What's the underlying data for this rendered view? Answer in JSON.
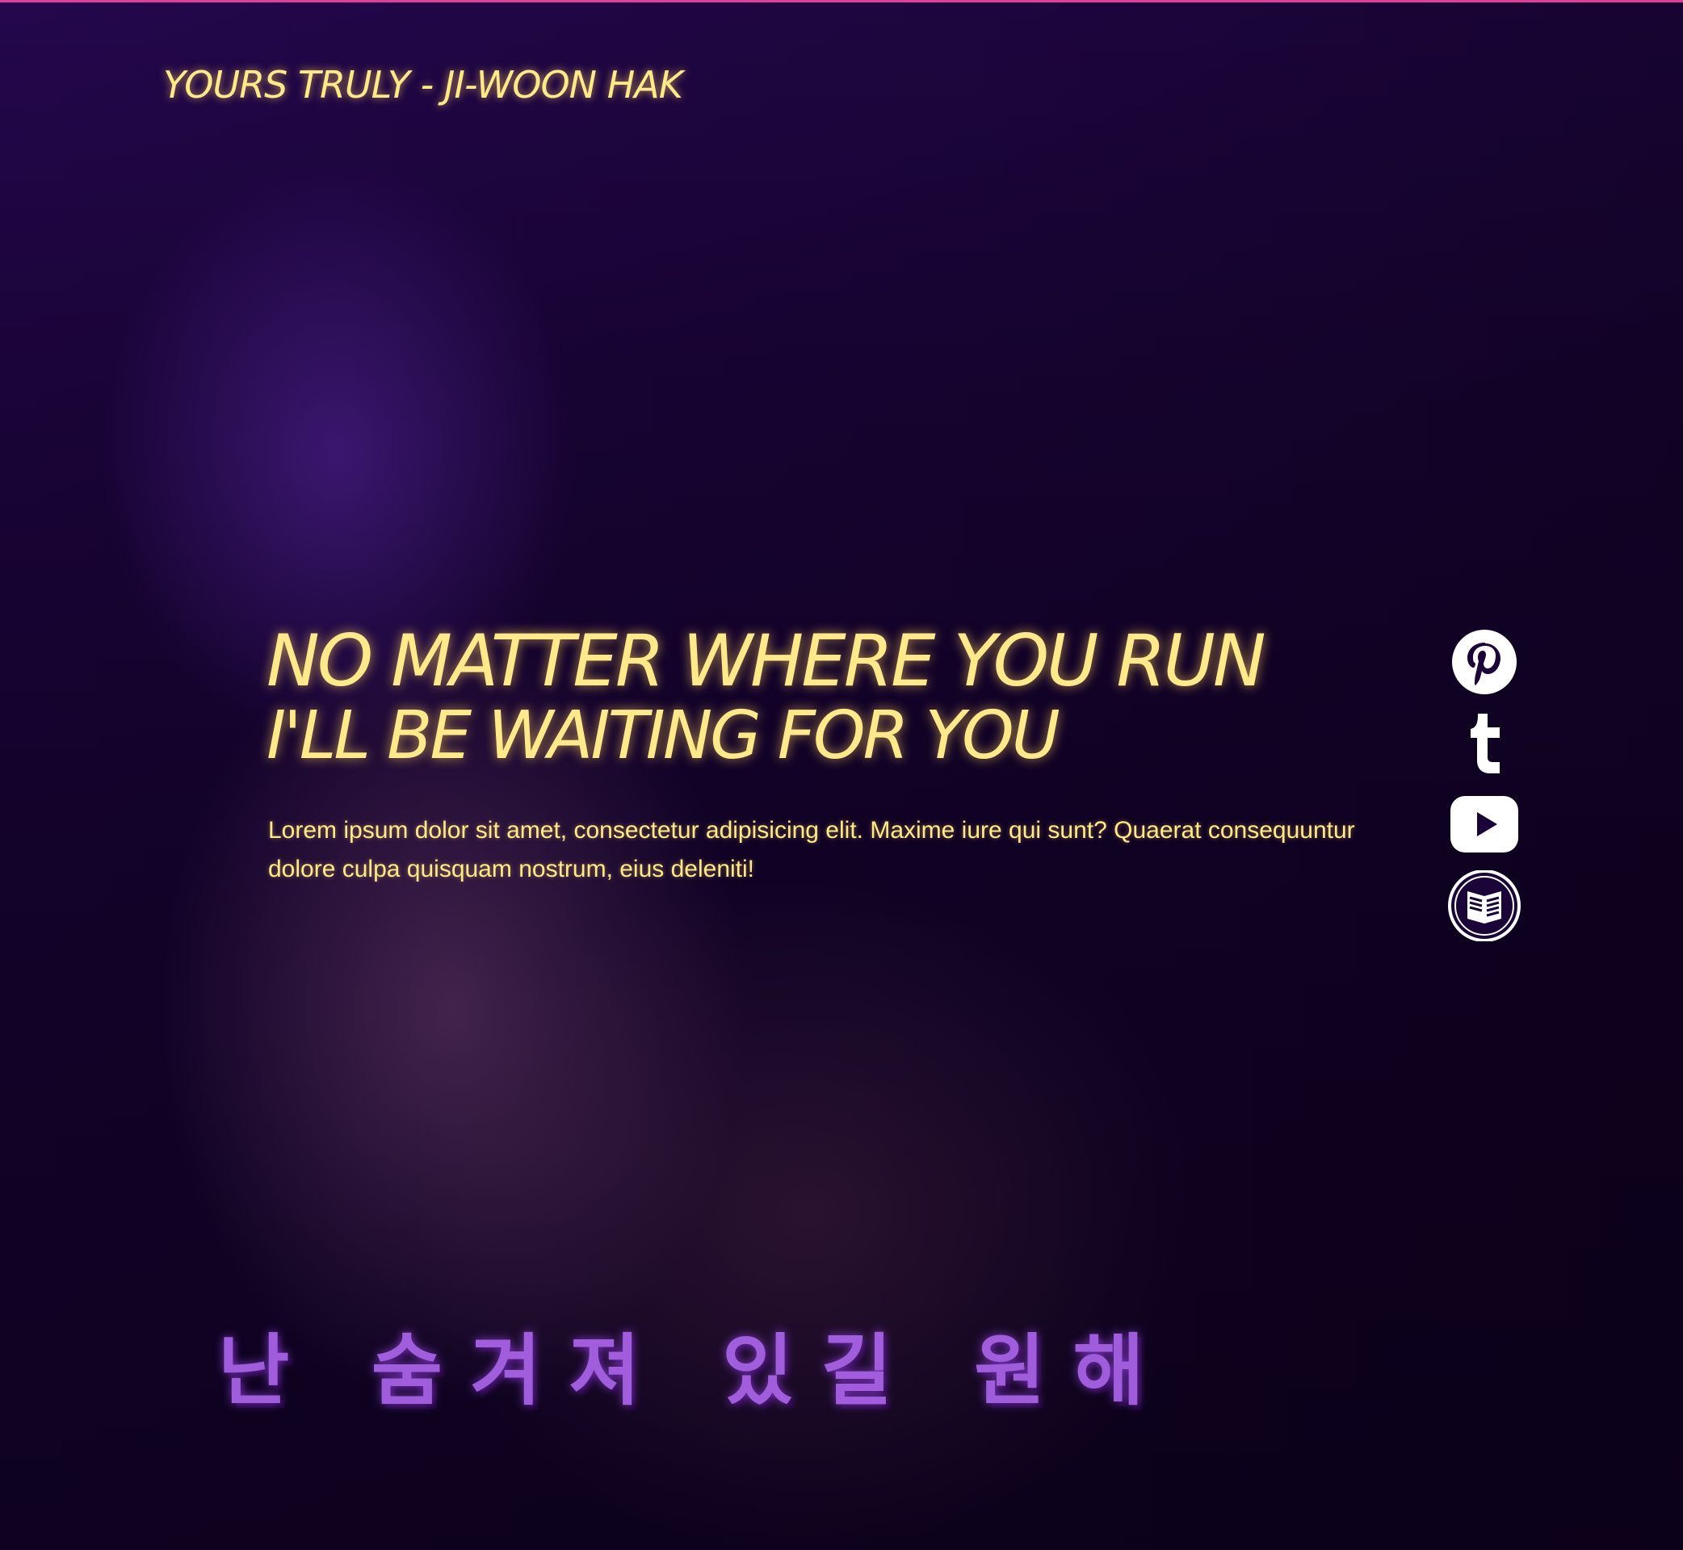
{
  "brand": {
    "title": "YOURS TRULY - JI-WOON HAK"
  },
  "hero": {
    "headline_line1": "NO MATTER WHERE YOU RUN",
    "headline_line2": "I'LL BE WAITING FOR YOU",
    "body": "Lorem ipsum dolor sit amet, consectetur adipisicing elit. Maxime iure qui sunt? Quaerat consequuntur dolore culpa quisquam nostrum, eius deleniti!",
    "subtitle_korean": "난 숨겨져 있길 원해"
  },
  "social": {
    "items": [
      {
        "icon": "pinterest-icon"
      },
      {
        "icon": "tumblr-icon"
      },
      {
        "icon": "youtube-icon"
      },
      {
        "icon": "carrd-icon"
      }
    ]
  },
  "colors": {
    "background": "#1a0438",
    "accent_top_bar": "#e0409a",
    "text_neon_yellow": "#ffe98a",
    "subtitle_purple": "#b067f0",
    "icon_white": "#ffffff"
  }
}
